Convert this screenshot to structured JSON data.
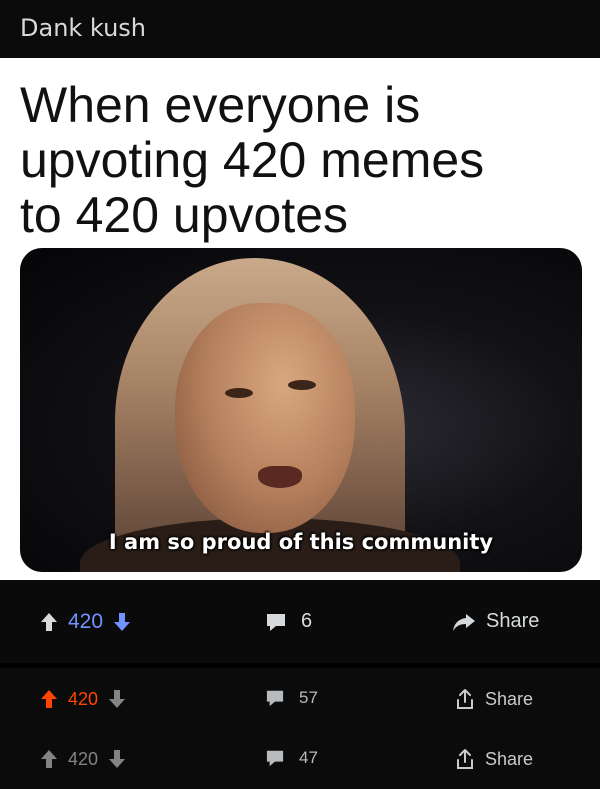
{
  "post": {
    "title": "Dank kush"
  },
  "meme": {
    "caption": "When everyone is\nupvoting 420 memes\nto 420 upvotes",
    "subtitle": "I am so proud of this community"
  },
  "rows": [
    {
      "score": "420",
      "comments": "6",
      "share": "Share",
      "vote_state": "downvoted",
      "score_color": "#7193ff"
    },
    {
      "score": "420",
      "comments": "57",
      "share": "Share",
      "vote_state": "upvoted",
      "score_color": "#ff4500"
    },
    {
      "score": "420",
      "comments": "47",
      "share": "Share",
      "vote_state": "none",
      "score_color": "#818384"
    }
  ],
  "icons": {
    "upvote": "upvote-arrow-icon",
    "downvote": "downvote-arrow-icon",
    "comment": "comment-bubble-icon",
    "share_forward": "share-forward-icon",
    "share_upload": "share-upload-icon"
  }
}
